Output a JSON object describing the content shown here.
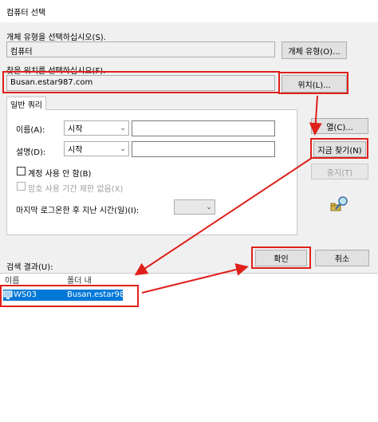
{
  "window": {
    "title": "컴퓨터 선택"
  },
  "object_type": {
    "label": "개체 유형을 선택하십시오(S).",
    "value": "컴퓨터",
    "button": "개체 유형(O)..."
  },
  "location": {
    "label": "찾을 위치를 선택하십시오(F).",
    "value": "Busan.estar987.com",
    "button": "위치(L)..."
  },
  "tab": {
    "label": "일반 쿼리"
  },
  "query": {
    "name_label": "이름(A):",
    "name_mode": "시작",
    "desc_label": "설명(D):",
    "desc_mode": "시작",
    "disabled_accounts": "계정 사용 안 함(B)",
    "non_expiring": "암호 사용 기간 제한 없음(X)",
    "days_since_logon": "마지막 로그온한 후 지난 시간(일)(I):"
  },
  "buttons": {
    "columns": "열(C)...",
    "find_now": "지금 찾기(N)",
    "stop": "중지(T)",
    "ok": "확인",
    "cancel": "취소"
  },
  "results": {
    "label": "검색 결과(U):",
    "columns": [
      "이름",
      "폴더 내"
    ],
    "rows": [
      {
        "name": "WS03",
        "folder": "Busan.estar98..."
      }
    ]
  },
  "icons": {
    "search_icon": "magnifier-icon",
    "computer_icon": "computer-icon"
  },
  "colors": {
    "highlight": "#e0201a",
    "selection": "#0078d7"
  }
}
